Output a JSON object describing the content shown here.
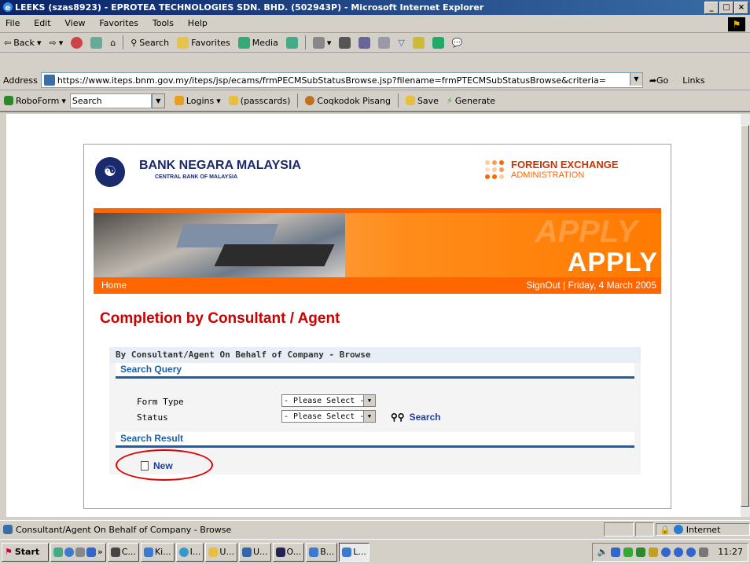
{
  "window": {
    "title": "LEEKS (szas8923) - EPROTEA TECHNOLOGIES SDN. BHD. (502943P) - Microsoft Internet Explorer",
    "controls": [
      "_",
      "□",
      "×"
    ]
  },
  "menu": [
    "File",
    "Edit",
    "View",
    "Favorites",
    "Tools",
    "Help"
  ],
  "toolbar": {
    "back": "Back",
    "search": "Search",
    "favorites": "Favorites",
    "media": "Media"
  },
  "address": {
    "label": "Address",
    "url": "https://www.iteps.bnm.gov.my/iteps/jsp/ecams/frmPECMSubStatusBrowse.jsp?filename=frmPTECMSubStatusBrowse&criteria=",
    "go": "Go",
    "links": "Links"
  },
  "robobar": {
    "roboform": "RoboForm",
    "search_value": "Search",
    "logins": "Logins",
    "passcards": "(passcards)",
    "identity": "Coqkodok Pisang",
    "save": "Save",
    "generate": "Generate"
  },
  "header": {
    "bank_name": "BANK NEGARA MALAYSIA",
    "bank_sub": "CENTRAL BANK OF MALAYSIA",
    "fx_title": "FOREIGN EXCHANGE",
    "fx_sub": "ADMINISTRATION",
    "banner_text": "APPLY"
  },
  "nav": {
    "home": "Home",
    "signout": "SignOut",
    "separator": "|",
    "date": "Friday, 4 March 2005"
  },
  "page": {
    "title": "Completion by Consultant / Agent",
    "panel_header": "By Consultant/Agent On Behalf of Company - Browse",
    "search_query": "Search Query",
    "form_type_label": "Form Type",
    "status_label": "Status",
    "form_type_value": "- Please Select -",
    "status_value": "- Please Select -",
    "search_button": "Search",
    "search_result": "Search Result",
    "new_button": "New"
  },
  "statusbar": {
    "message": "Consultant/Agent On Behalf of Company - Browse",
    "zone": "Internet"
  },
  "taskbar": {
    "start": "Start",
    "items": [
      "C...",
      "Ki...",
      "I...",
      "U...",
      "U...",
      "O...",
      "B...",
      "L..."
    ],
    "clock": "11:27"
  },
  "colors": {
    "accent_orange": "#ff6600",
    "title_red": "#cc0000",
    "link_blue": "#1a3fa6",
    "bnm_navy": "#1a2a6c",
    "highlight_red": "#e00000"
  }
}
